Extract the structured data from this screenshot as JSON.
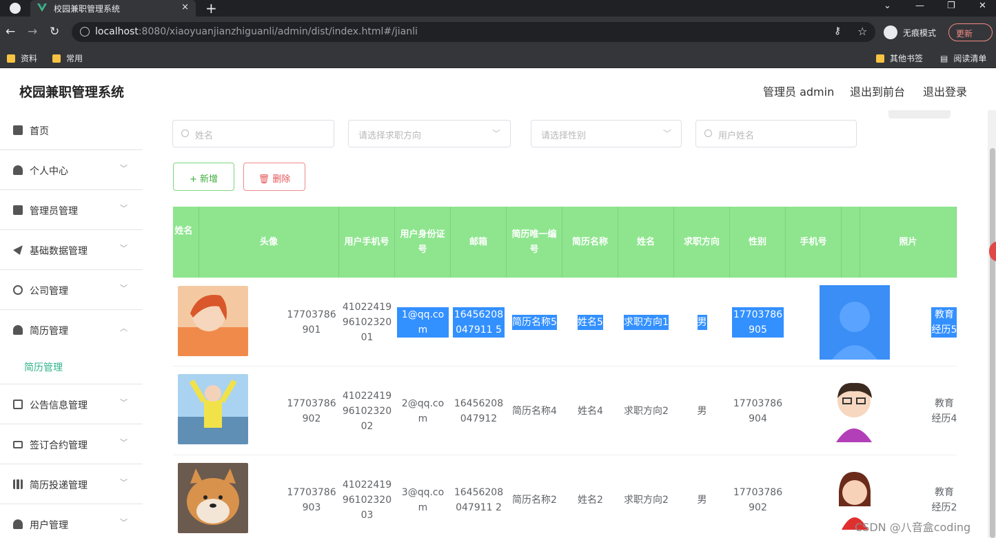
{
  "browser": {
    "tab_title": "校园兼职管理系统",
    "tab_close": "×",
    "new_tab": "+",
    "url_host": "localhost",
    "url_rest": ":8080/xiaoyuanjianzhiguanli/admin/dist/index.html#/jianli",
    "incognito_label": "无痕模式",
    "update_label": "更新",
    "bookmarks": [
      "资料",
      "常用"
    ],
    "bookmarks_right": [
      "其他书签",
      "阅读清单"
    ]
  },
  "header": {
    "brand": "校园兼职管理系统",
    "admin_label": "管理员 admin",
    "to_front": "退出到前台",
    "logout": "退出登录"
  },
  "sidebar": {
    "items": [
      {
        "label": "首页",
        "icon": "home-icon"
      },
      {
        "label": "个人中心",
        "icon": "user-icon"
      },
      {
        "label": "管理员管理",
        "icon": "chart-icon"
      },
      {
        "label": "基础数据管理",
        "icon": "send-icon"
      },
      {
        "label": "公司管理",
        "icon": "compass-icon"
      },
      {
        "label": "简历管理",
        "icon": "user-icon"
      },
      {
        "label": "公告信息管理",
        "icon": "copy-icon"
      },
      {
        "label": "签订合约管理",
        "icon": "card-icon"
      },
      {
        "label": "简历投递管理",
        "icon": "bar-chart-icon"
      },
      {
        "label": "用户管理",
        "icon": "user-icon"
      }
    ],
    "active_sub": "简历管理"
  },
  "filters": {
    "name_placeholder": "姓名",
    "direction_placeholder": "请选择求职方向",
    "gender_placeholder": "请选择性别",
    "username_placeholder": "用户姓名"
  },
  "actions": {
    "add": "+ 新增",
    "delete": "删除"
  },
  "table": {
    "headers": [
      "姓名",
      "头像",
      "用户手机号",
      "用户身份证号",
      "邮箱",
      "简历唯一编号",
      "简历名称",
      "姓名",
      "求职方向",
      "性别",
      "手机号",
      "",
      "照片"
    ],
    "rows": [
      {
        "phone": "17703786901",
        "idcard": "410224199610232001",
        "email": "1@qq.com",
        "resume_no": "16456208047911 5",
        "resume_name": "简历名称5",
        "name": "姓名5",
        "direction": "求职方向1",
        "gender": "男",
        "mobile": "17703786905",
        "edu": "教育经历5"
      },
      {
        "phone": "17703786902",
        "idcard": "410224199610232002",
        "email": "2@qq.com",
        "resume_no": "16456208047912",
        "resume_name": "简历名称4",
        "name": "姓名4",
        "direction": "求职方向2",
        "gender": "男",
        "mobile": "17703786904",
        "edu": "教育经历4"
      },
      {
        "phone": "17703786903",
        "idcard": "410224199610232003",
        "email": "3@qq.com",
        "resume_no": "16456208047911 2",
        "resume_name": "简历名称2",
        "name": "姓名2",
        "direction": "求职方向2",
        "gender": "男",
        "mobile": "17703786902",
        "edu": "教育经历2"
      }
    ]
  },
  "watermark": "CSDN @八音盒coding",
  "colors": {
    "accent": "#2fb38a",
    "table_header": "#8ee58e",
    "highlight": "#3390ff"
  }
}
